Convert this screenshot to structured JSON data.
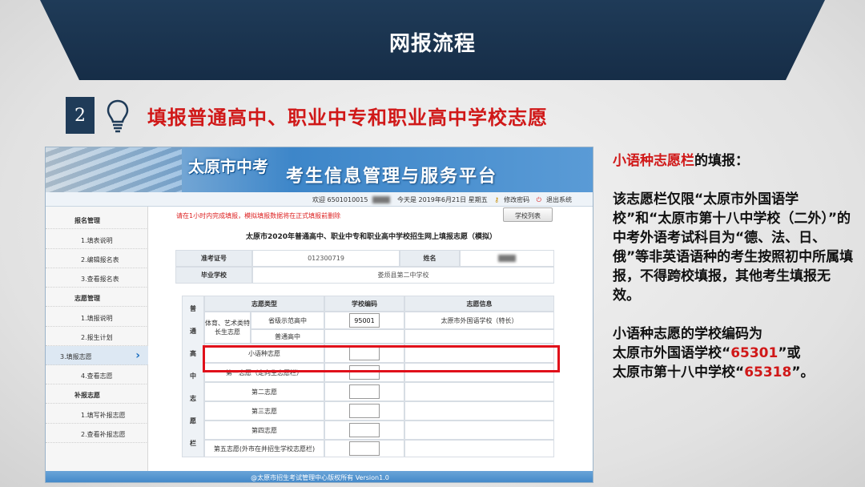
{
  "banner": {
    "title": "网报流程"
  },
  "step": {
    "number": "2",
    "title": "填报普通高中、职业中专和职业高中学校志愿"
  },
  "portal": {
    "logo": "太原市中考",
    "platform_title": "考生信息管理与服务平台",
    "info_bar": {
      "welcome": "欢迎 6501010015",
      "today": "今天是 2019年6月21日 星期五",
      "change_password": "修改密码",
      "logout": "退出系统"
    },
    "sidebar": [
      {
        "label": "报名管理",
        "kind": "head"
      },
      {
        "label": "1.填表说明",
        "kind": "item"
      },
      {
        "label": "2.编辑报名表",
        "kind": "item"
      },
      {
        "label": "3.查看报名表",
        "kind": "item"
      },
      {
        "label": "志愿管理",
        "kind": "head"
      },
      {
        "label": "1.填报说明",
        "kind": "item"
      },
      {
        "label": "2.报生计划",
        "kind": "item"
      },
      {
        "label": "3.填报志愿",
        "kind": "active"
      },
      {
        "label": "4.查看志愿",
        "kind": "item"
      },
      {
        "label": "补报志愿",
        "kind": "head"
      },
      {
        "label": "1.填写补报志愿",
        "kind": "item"
      },
      {
        "label": "2.查看补报志愿",
        "kind": "item"
      }
    ],
    "notice": "请在1小时内完成填报，模拟填报数据将在正式填报前删除",
    "school_list_button": "学校列表",
    "form_title": "太原市2020年普通高中、职业中专和职业高中学校招生网上填报志愿（模拟）",
    "exam_number_label": "准考证号",
    "exam_number_value": "012300719",
    "name_label": "姓名",
    "grad_school_label": "毕业学校",
    "grad_school_value": "娄烦县第二中学校",
    "table": {
      "headers": [
        "志愿类型",
        "学校编码",
        "志愿信息"
      ],
      "group_label": [
        "普",
        "通",
        "高",
        "中",
        "志",
        "愿",
        "栏"
      ],
      "special_label": "体育、艺术类特长生志愿",
      "rows": [
        {
          "type": "省级示范高中",
          "code": "95001",
          "info": "太原市外国语学校（特长）"
        },
        {
          "type": "普通高中",
          "code": "",
          "info": ""
        },
        {
          "type": "小语种志愿",
          "code": "",
          "info": ""
        },
        {
          "type": "第一志愿（定向生志愿栏）",
          "code": "",
          "info": ""
        },
        {
          "type": "第二志愿",
          "code": "",
          "info": ""
        },
        {
          "type": "第三志愿",
          "code": "",
          "info": ""
        },
        {
          "type": "第四志愿",
          "code": "",
          "info": ""
        },
        {
          "type": "第五志愿(外市在并招生学校志愿栏)",
          "code": "",
          "info": ""
        }
      ]
    },
    "footer": "@太原市招生考试管理中心版权所有 Version1.0"
  },
  "explanation": {
    "heading_red": "小语种志愿栏",
    "heading_rest": "的填报：",
    "para1": "该志愿栏仅限“太原市外国语学校”和“太原市第十八中学校（二外）”的中考外语考试科目为“德、法、日、俄”等非英语语种的考生按照初中所属填报，不得跨校填报，其他考生填报无效。",
    "para2_lead": "小语种志愿的学校编码为",
    "school1": "太原市外国语学校“",
    "code1": "65301",
    "mid": "”或",
    "school2": "太原市第十八中学校“",
    "code2": "65318",
    "end": "”。"
  },
  "colors": {
    "banner": "#1f3b58",
    "title_red": "#d01818",
    "highlight": "#e0101a",
    "portal_blue": "#3f86c8"
  }
}
